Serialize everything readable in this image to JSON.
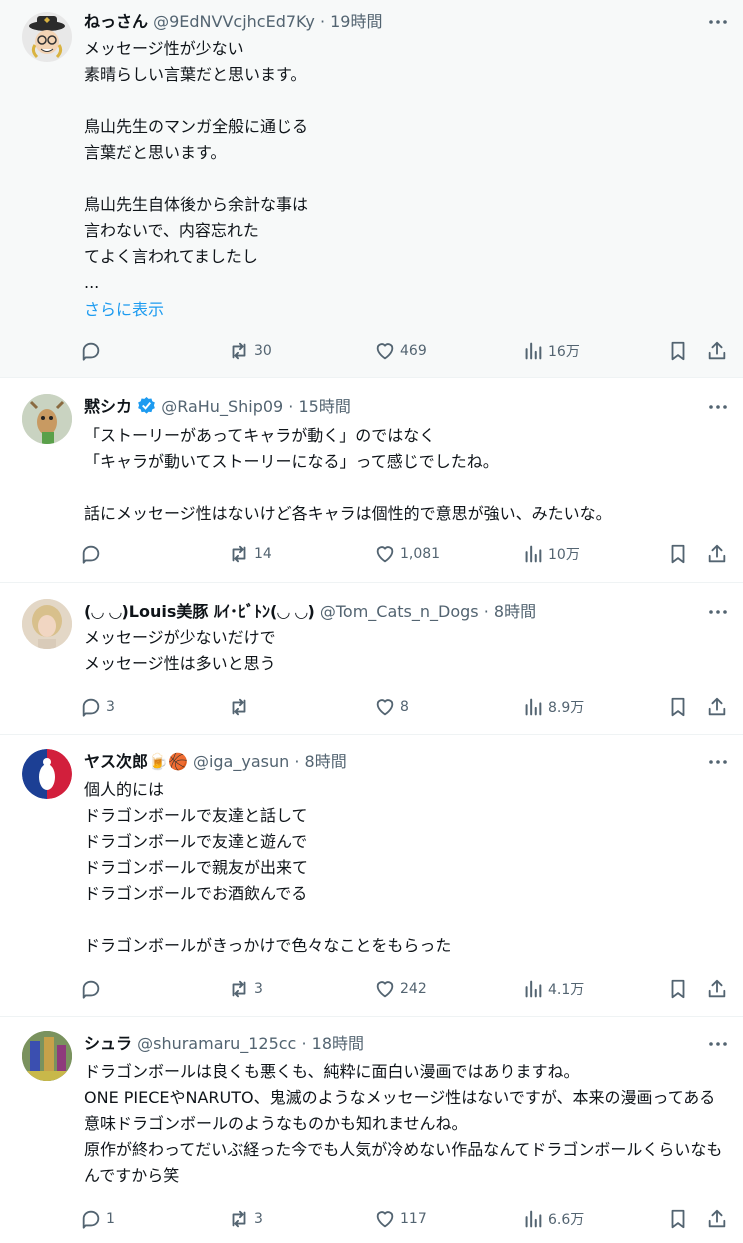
{
  "ui": {
    "show_more": "さらに表示"
  },
  "tweets": [
    {
      "name": "ねっさん",
      "handle": "@9EdNVVcjhcEd7Ky",
      "time": "19時間",
      "text": "メッセージ性が少ない\n素晴らしい言葉だと思います。\n\n鳥山先生のマンガ全般に通じる\n言葉だと思います。\n\n鳥山先生自体後から余計な事は\n言わないで、内容忘れた\nてよく言われてましたし\n...",
      "replies": "",
      "reposts": "30",
      "likes": "469",
      "views": "16万"
    },
    {
      "name": "黙シカ",
      "handle": "@RaHu_Ship09",
      "time": "15時間",
      "verified": true,
      "text": "「ストーリーがあってキャラが動く」のではなく\n「キャラが動いてストーリーになる」って感じでしたね。\n\n話にメッセージ性はないけど各キャラは個性的で意思が強い、みたいな。",
      "replies": "",
      "reposts": "14",
      "likes": "1,081",
      "views": "10万"
    },
    {
      "name": "(◡ ◡)Louis美豚 ﾙｲ･ﾋﾞﾄﾝ(◡ ◡)",
      "handle": "@Tom_Cats_n_Dogs",
      "time": "8時間",
      "text": "メッセージが少ないだけで\nメッセージ性は多いと思う",
      "replies": "3",
      "reposts": "",
      "likes": "8",
      "views": "8.9万"
    },
    {
      "name": "ヤス次郎",
      "name_emoji": "🍺🏀",
      "handle": "@iga_yasun",
      "time": "8時間",
      "text": "個人的には\nドラゴンボールで友達と話して\nドラゴンボールで友達と遊んで\nドラゴンボールで親友が出来て\nドラゴンボールでお酒飲んでる\n\nドラゴンボールがきっかけで色々なことをもらった",
      "replies": "",
      "reposts": "3",
      "likes": "242",
      "views": "4.1万"
    },
    {
      "name": "シュラ",
      "handle": "@shuramaru_125cc",
      "time": "18時間",
      "text": "ドラゴンボールは良くも悪くも、純粋に面白い漫画ではありますね。\nONE PIECEやNARUTO、鬼滅のようなメッセージ性はないですが、本来の漫画ってある意味ドラゴンボールのようなものかも知れませんね。\n原作が終わってだいぶ経った今でも人気が冷めない作品なんてドラゴンボールくらいなもんですから笑",
      "replies": "1",
      "reposts": "3",
      "likes": "117",
      "views": "6.6万"
    }
  ],
  "colors": {
    "text": "#0f1419",
    "secondary": "#536471",
    "link": "#1d9bf0",
    "verified": "#1d9bf0",
    "divider": "#eff3f4",
    "highlight_bg": "#f7f9f9"
  },
  "icons": [
    "more-icon",
    "reply-icon",
    "repost-icon",
    "like-icon",
    "views-icon",
    "bookmark-icon",
    "share-icon",
    "verified-icon"
  ]
}
